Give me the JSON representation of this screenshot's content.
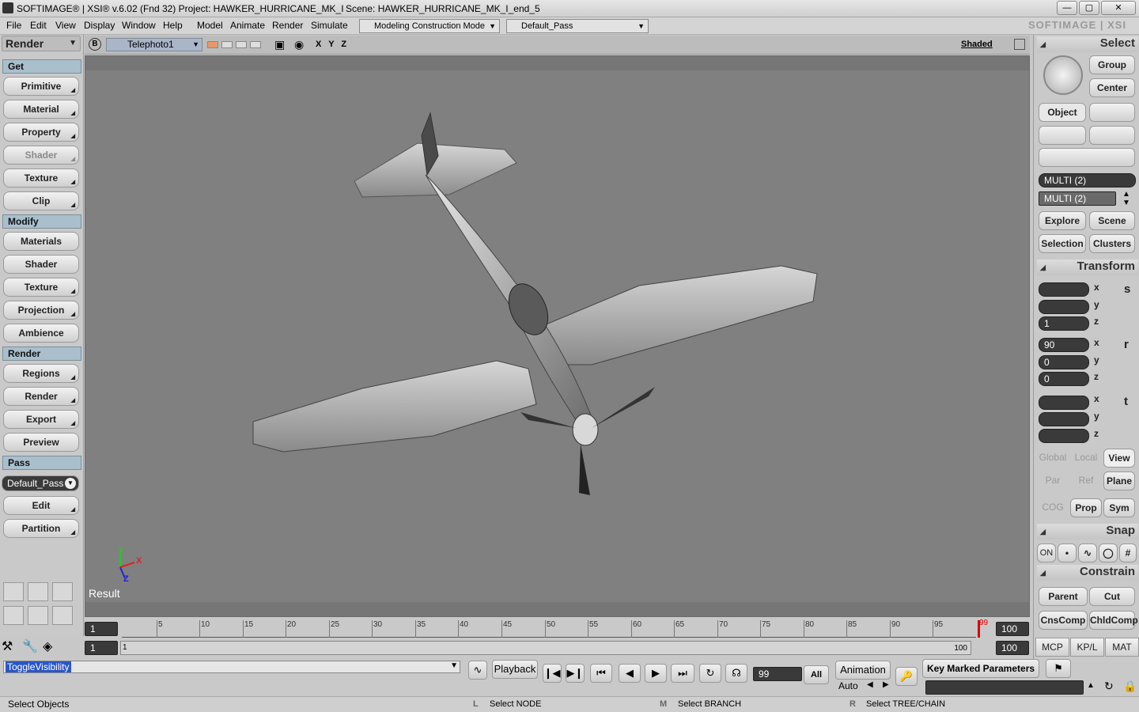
{
  "titlebar": {
    "app": "SOFTIMAGE® | XSI® v.6.02 (Fnd 32) Project: HAWKER_HURRICANE_MK_I",
    "scene": "Scene: HAWKER_HURRICANE_MK_I_end_5",
    "brand": "SOFTIMAGE | XSI"
  },
  "menu": {
    "file": "File",
    "edit": "Edit",
    "view": "View",
    "display": "Display",
    "window": "Window",
    "help": "Help",
    "model": "Model",
    "animate": "Animate",
    "render": "Render",
    "simulate": "Simulate",
    "mode": "Modeling Construction Mode",
    "pass": "Default_Pass"
  },
  "left": {
    "module": "Render",
    "get": "Get",
    "modify": "Modify",
    "render": "Render",
    "pass": "Pass",
    "get_items": [
      "Primitive",
      "Material",
      "Property",
      "Shader",
      "Texture",
      "Clip"
    ],
    "modify_items": [
      "Materials",
      "Shader",
      "Texture",
      "Projection",
      "Ambience"
    ],
    "render_items": [
      "Regions",
      "Render",
      "Export",
      "Preview"
    ],
    "pass_value": "Default_Pass",
    "pass_items": [
      "Edit",
      "Partition"
    ]
  },
  "viewport": {
    "camera": "Telephoto1",
    "badge": "B",
    "axes": "X Y Z",
    "shading": "Shaded",
    "label": "Result",
    "axis_x": "X",
    "axis_y": "Y",
    "axis_z": "Z"
  },
  "right": {
    "select": "Select",
    "group": "Group",
    "center": "Center",
    "object": "Object",
    "multi1": "MULTI (2)",
    "multi2": "MULTI (2)",
    "explore": "Explore",
    "scene": "Scene",
    "selection": "Selection",
    "clusters": "Clusters",
    "transform": "Transform",
    "scale": [
      "",
      "",
      "1"
    ],
    "rotate": [
      "90",
      "0",
      "0"
    ],
    "translate": [
      "",
      "",
      ""
    ],
    "x": "x",
    "y": "y",
    "z": "z",
    "s": "s",
    "r": "r",
    "t": "t",
    "global": "Global",
    "local": "Local",
    "view": "View",
    "par": "Par",
    "ref": "Ref",
    "plane": "Plane",
    "cog": "COG",
    "prop": "Prop",
    "sym": "Sym",
    "snap": "Snap",
    "on": "ON",
    "constrain": "Constrain",
    "parent": "Parent",
    "cut": "Cut",
    "cnscomp": "CnsComp",
    "chldcomp": "ChldComp",
    "mcp": "MCP",
    "kpl": "KP/L",
    "mat": "MAT"
  },
  "timeline": {
    "start": "1",
    "end_a": "100",
    "end_b": "100",
    "cur_start": "1",
    "cur_label": "1",
    "marker": "99",
    "range_end": "100",
    "ticks": [
      "5",
      "10",
      "15",
      "20",
      "25",
      "30",
      "35",
      "40",
      "45",
      "50",
      "55",
      "60",
      "65",
      "70",
      "75",
      "80",
      "85",
      "90",
      "95"
    ]
  },
  "playback": {
    "command": "ToggleVisibility",
    "playback": "Playback",
    "frame": "99",
    "all": "All",
    "animation": "Animation",
    "auto": "Auto",
    "key_marked": "Key Marked Parameters"
  },
  "status": {
    "left": "Select Objects",
    "l_key": "L",
    "l_text": "Select NODE",
    "m_key": "M",
    "m_text": "Select BRANCH",
    "r_key": "R",
    "r_text": "Select TREE/CHAIN"
  }
}
